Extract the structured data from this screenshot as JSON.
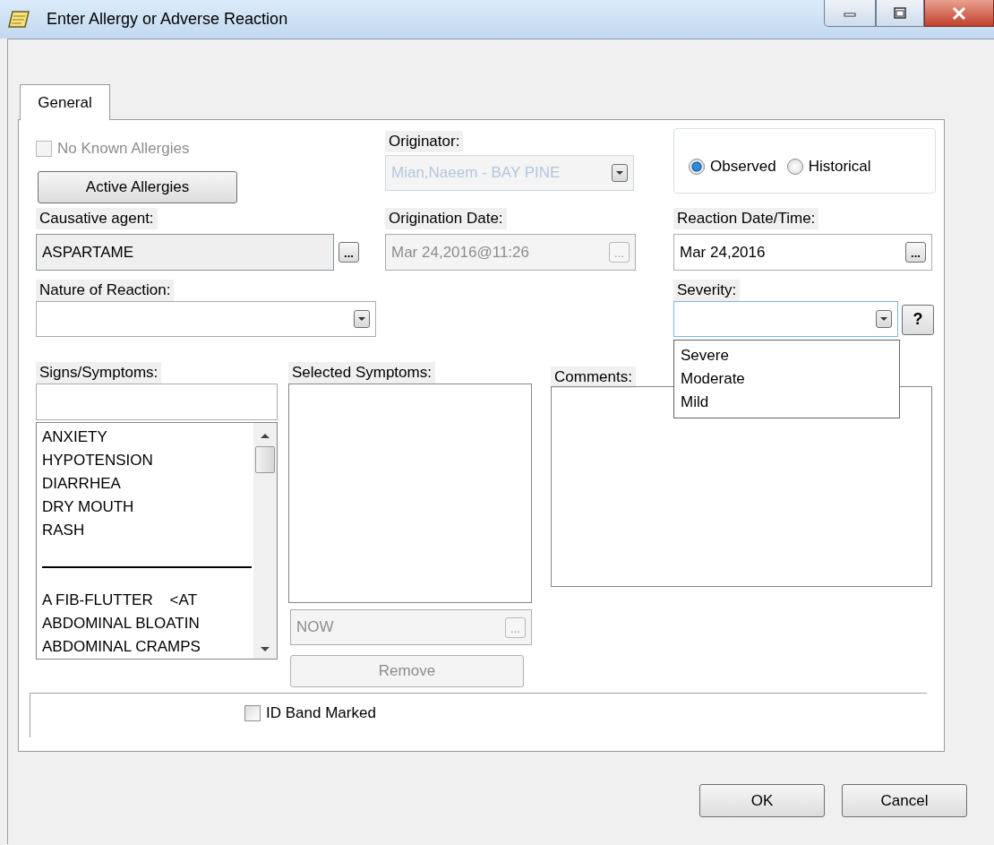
{
  "window": {
    "title": "Enter Allergy or Adverse Reaction"
  },
  "tabs": [
    {
      "label": "General",
      "selected": true
    }
  ],
  "no_known_allergies": {
    "label": "No Known Allergies",
    "checked": false,
    "disabled": true
  },
  "active_allergies_button": {
    "label": "Active Allergies"
  },
  "originator": {
    "label": "Originator:",
    "value": "Mian,Naeem - BAY PINE",
    "disabled": true
  },
  "reaction_type": {
    "options": [
      {
        "label": "Observed",
        "selected": true
      },
      {
        "label": "Historical",
        "selected": false
      }
    ]
  },
  "causative_agent": {
    "label": "Causative agent:",
    "value": "ASPARTAME",
    "button": "..."
  },
  "origination_date": {
    "label": "Origination Date:",
    "value": "Mar 24,2016@11:26",
    "disabled": true,
    "button": "..."
  },
  "reaction_date_time": {
    "label": "Reaction Date/Time:",
    "value": "Mar 24,2016",
    "button": "..."
  },
  "nature_of_reaction": {
    "label": "Nature of Reaction:"
  },
  "severity": {
    "label": "Severity:",
    "help_button": "?",
    "open": true,
    "options": [
      "Severe",
      "Moderate",
      "Mild"
    ]
  },
  "signs_symptoms": {
    "label": "Signs/Symptoms:",
    "items": [
      {
        "kind": "item",
        "text": "ANXIETY"
      },
      {
        "kind": "item",
        "text": "HYPOTENSION"
      },
      {
        "kind": "item",
        "text": "DIARRHEA"
      },
      {
        "kind": "item",
        "text": "DRY MOUTH"
      },
      {
        "kind": "item",
        "text": "RASH"
      },
      {
        "kind": "separator"
      },
      {
        "kind": "item",
        "text": "A FIB-FLUTTER    <AT"
      },
      {
        "kind": "item",
        "text": "ABDOMINAL BLOATIN"
      },
      {
        "kind": "item",
        "text": "ABDOMINAL CRAMPS"
      }
    ]
  },
  "selected_symptoms": {
    "label": "Selected Symptoms:",
    "date_field": {
      "value": "NOW",
      "disabled": true,
      "button": "..."
    },
    "remove_button": {
      "label": "Remove",
      "disabled": true
    }
  },
  "comments": {
    "label": "Comments:"
  },
  "id_band_marked": {
    "label": "ID Band Marked",
    "checked": false
  },
  "buttons": [
    {
      "label": "OK"
    },
    {
      "label": "Cancel"
    }
  ]
}
